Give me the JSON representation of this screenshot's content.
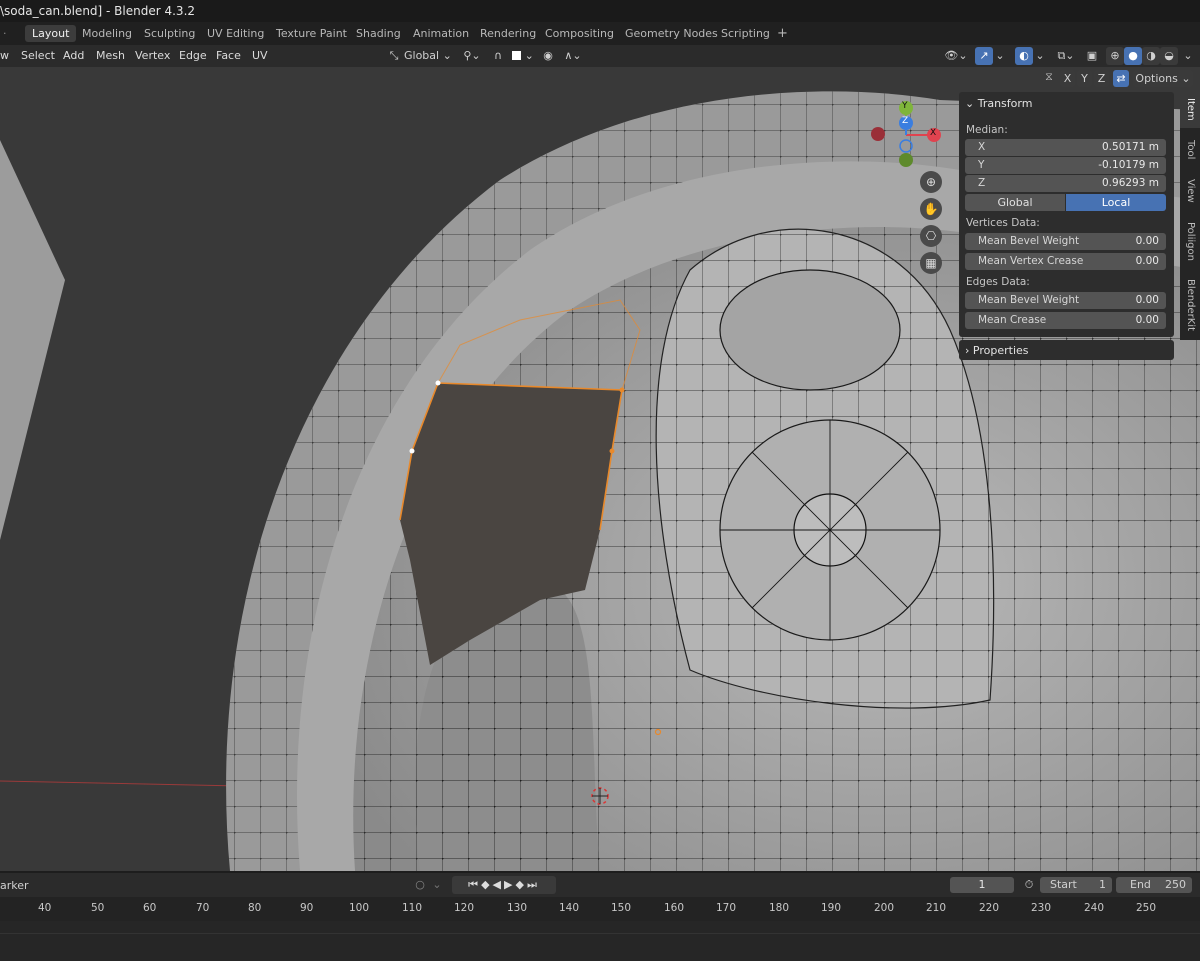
{
  "title": "\\soda_can.blend] - Blender 4.3.2",
  "workspace_tabs": [
    "Layout",
    "Modeling",
    "Sculpting",
    "UV Editing",
    "Texture Paint",
    "Shading",
    "Animation",
    "Rendering",
    "Compositing",
    "Geometry Nodes",
    "Scripting",
    "+"
  ],
  "header_menu": [
    "w",
    "Select",
    "Add",
    "Mesh",
    "Vertex",
    "Edge",
    "Face",
    "UV"
  ],
  "orientation": "Global",
  "gizmo_axes": [
    "X",
    "Y",
    "Z"
  ],
  "options_label": "Options",
  "n_panel": {
    "transform_title": "Transform",
    "median_label": "Median:",
    "x": {
      "label": "X",
      "value": "0.50171 m"
    },
    "y": {
      "label": "Y",
      "value": "-0.10179 m"
    },
    "z": {
      "label": "Z",
      "value": "0.96293 m"
    },
    "global_label": "Global",
    "local_label": "Local",
    "vertices_label": "Vertices Data:",
    "mean_bevel_weight_v": {
      "label": "Mean Bevel Weight",
      "value": "0.00"
    },
    "mean_vertex_crease": {
      "label": "Mean Vertex Crease",
      "value": "0.00"
    },
    "edges_label": "Edges Data:",
    "mean_bevel_weight_e": {
      "label": "Mean Bevel Weight",
      "value": "0.00"
    },
    "mean_crease": {
      "label": "Mean Crease",
      "value": "0.00"
    },
    "properties_title": "Properties"
  },
  "side_tabs": [
    "Item",
    "Tool",
    "View",
    "Poliigon",
    "BlenderKit"
  ],
  "timeline": {
    "marker_label": "arker",
    "current_frame": "1",
    "start_label": "Start",
    "start_value": "1",
    "end_label": "End",
    "end_value": "250",
    "ruler": [
      "40",
      "50",
      "60",
      "70",
      "80",
      "90",
      "100",
      "110",
      "120",
      "130",
      "140",
      "150",
      "160",
      "170",
      "180",
      "190",
      "200",
      "210",
      "220",
      "230",
      "240",
      "250"
    ]
  },
  "colors": {
    "accent_blue": "#4772b3",
    "selection_orange": "#e8892b",
    "axis_x": "#e0434f",
    "axis_y": "#7fb53a",
    "axis_z": "#3a7ee0"
  }
}
